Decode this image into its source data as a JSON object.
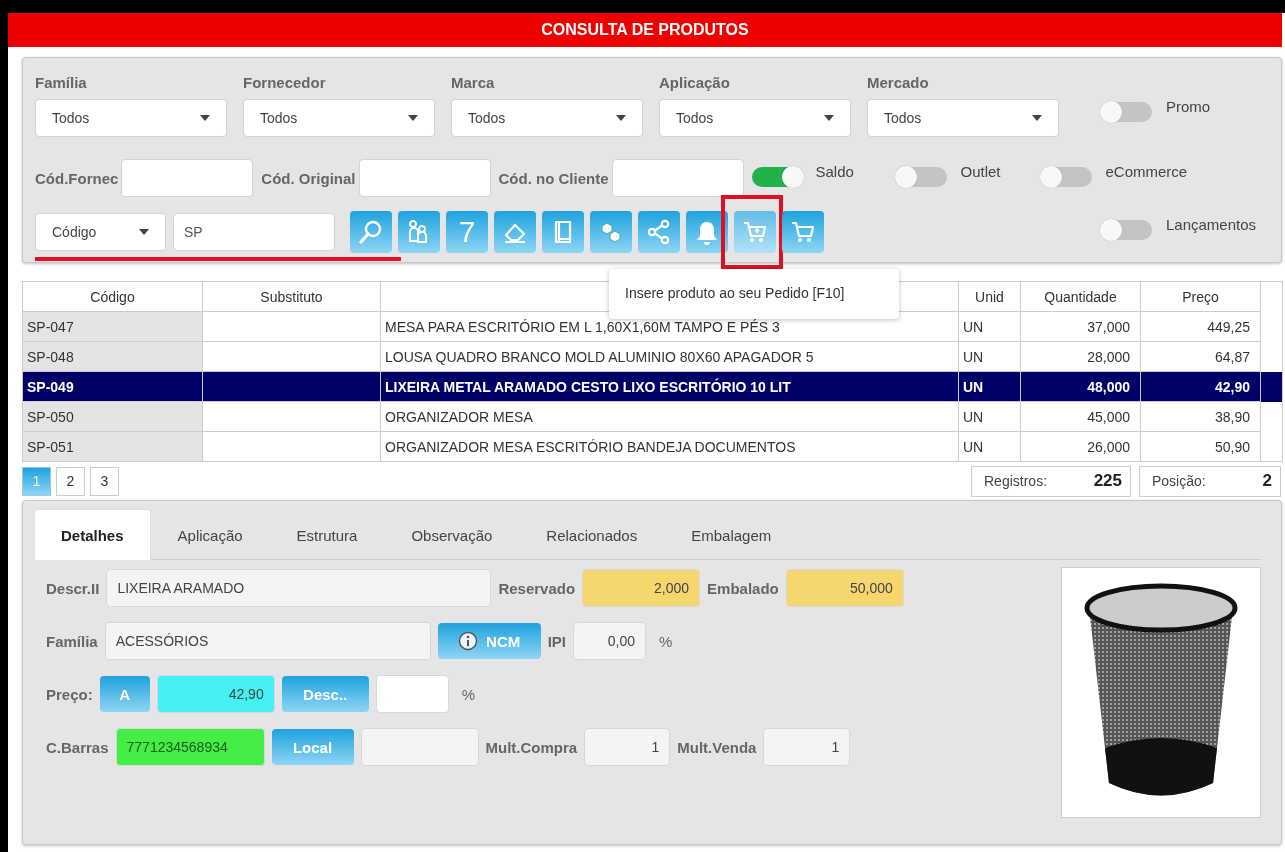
{
  "window": {
    "title": "CONSULTA DE PRODUTOS"
  },
  "filters": {
    "dropdowns": [
      {
        "label": "Família",
        "value": "Todos"
      },
      {
        "label": "Fornecedor",
        "value": "Todos"
      },
      {
        "label": "Marca",
        "value": "Todos"
      },
      {
        "label": "Aplicação",
        "value": "Todos"
      },
      {
        "label": "Mercado",
        "value": "Todos"
      }
    ],
    "code_fields": [
      {
        "label": "Cód.Fornec"
      },
      {
        "label": "Cód. Original"
      },
      {
        "label": "Cód. no Cliente"
      }
    ],
    "toggles": [
      {
        "label": "Promo",
        "on": false
      },
      {
        "label": "Saldo",
        "on": true
      },
      {
        "label": "Outlet",
        "on": false
      },
      {
        "label": "eCommerce",
        "on": false
      },
      {
        "label": "Lançamentos",
        "on": false
      }
    ],
    "search": {
      "field": "Código",
      "value": "SP",
      "underlined": true
    },
    "toolbar": [
      {
        "kind": "search",
        "highlighted": false
      },
      {
        "kind": "users",
        "highlighted": false
      },
      {
        "kind": "glyph",
        "text": "7",
        "highlighted": false
      },
      {
        "kind": "eraser",
        "highlighted": false
      },
      {
        "kind": "book",
        "highlighted": false
      },
      {
        "kind": "boxes",
        "highlighted": false
      },
      {
        "kind": "share",
        "highlighted": false
      },
      {
        "kind": "bell",
        "highlighted": false
      },
      {
        "kind": "cart-add",
        "highlighted": true,
        "tooltip": "Insere produto ao seu Pedido [F10]"
      },
      {
        "kind": "cart",
        "highlighted": false
      }
    ]
  },
  "table": {
    "columns": [
      "Código",
      "Substituto",
      null,
      "Unid",
      "Quantidade",
      "Preço"
    ],
    "rows": [
      {
        "cells": [
          "SP-047",
          null,
          "MESA PARA ESCRITÓRIO EM L 1,60X1,60M TAMPO E PÉS 3",
          "UN",
          "37,000",
          "449,25"
        ],
        "selected": false
      },
      {
        "cells": [
          "SP-048",
          null,
          "LOUSA QUADRO BRANCO MOLD ALUMINIO 80X60 APAGADOR 5",
          "UN",
          "28,000",
          "64,87"
        ],
        "selected": false
      },
      {
        "cells": [
          "SP-049",
          null,
          "LIXEIRA METAL ARAMADO CESTO LIXO ESCRITÓRIO 10 LIT",
          "UN",
          "48,000",
          "42,90"
        ],
        "selected": true
      },
      {
        "cells": [
          "SP-050",
          null,
          "ORGANIZADOR MESA",
          "UN",
          "45,000",
          "38,90"
        ],
        "selected": false
      },
      {
        "cells": [
          "SP-051",
          null,
          "ORGANIZADOR MESA ESCRITÓRIO BANDEJA DOCUMENTOS",
          "UN",
          "26,000",
          "50,90"
        ],
        "selected": false
      }
    ]
  },
  "pagination": {
    "pages": [
      {
        "label": "1",
        "selected": true
      },
      {
        "label": "2",
        "selected": false
      },
      {
        "label": "3",
        "selected": false
      }
    ],
    "records": {
      "label": "Registros:",
      "value": "225"
    },
    "position": {
      "label": "Posição:",
      "value": "2"
    }
  },
  "details": {
    "tabs": [
      {
        "label": "Detalhes",
        "selected": true
      },
      {
        "label": "Aplicação",
        "selected": false
      },
      {
        "label": "Estrutura",
        "selected": false
      },
      {
        "label": "Observação",
        "selected": false
      },
      {
        "label": "Relacionados",
        "selected": false
      },
      {
        "label": "Embalagem",
        "selected": false
      }
    ],
    "form_rows": [
      [
        {
          "kind": "label",
          "text": "Descr.II"
        },
        {
          "kind": "text_field",
          "value": "LIXEIRA ARAMADO",
          "color": "#f4f4f4"
        },
        {
          "kind": "label",
          "text": "Reservado"
        },
        {
          "kind": "number_field",
          "value": "2,000",
          "color": "#f5d76e"
        },
        {
          "kind": "label",
          "text": "Embalado"
        },
        {
          "kind": "number_field",
          "value": "50,000",
          "color": "#f5d76e"
        }
      ],
      [
        {
          "kind": "label",
          "text": "Família"
        },
        {
          "kind": "text_field",
          "value": "ACESSÓRIOS",
          "color": "#f4f4f4"
        },
        {
          "kind": "info_button",
          "text": "NCM"
        },
        {
          "kind": "label",
          "text": "IPI"
        },
        {
          "kind": "number_field",
          "value": "0,00",
          "color": "#f4f4f4"
        },
        {
          "kind": "unit",
          "text": "%"
        }
      ],
      [
        {
          "kind": "label",
          "text": "Preço:"
        },
        {
          "kind": "button",
          "text": "A"
        },
        {
          "kind": "number_field",
          "value": "42,90",
          "color": "#45f0f0"
        },
        {
          "kind": "button",
          "text": "Desc.."
        },
        {
          "kind": "number_field",
          "color": "#ffffff"
        },
        {
          "kind": "unit",
          "text": "%"
        }
      ],
      [
        {
          "kind": "label",
          "text": "C.Barras"
        },
        {
          "kind": "text_field",
          "value": "7771234568934",
          "color": "#44ee44"
        },
        {
          "kind": "button",
          "text": "Local"
        },
        {
          "kind": "text_field",
          "color": "#f4f4f4"
        },
        {
          "kind": "label",
          "text": "Mult.Compra"
        },
        {
          "kind": "number_field",
          "value": "1",
          "color": "#f4f4f4"
        },
        {
          "kind": "label",
          "text": "Mult.Venda"
        },
        {
          "kind": "number_field",
          "value": "1",
          "color": "#f4f4f4"
        }
      ]
    ]
  }
}
